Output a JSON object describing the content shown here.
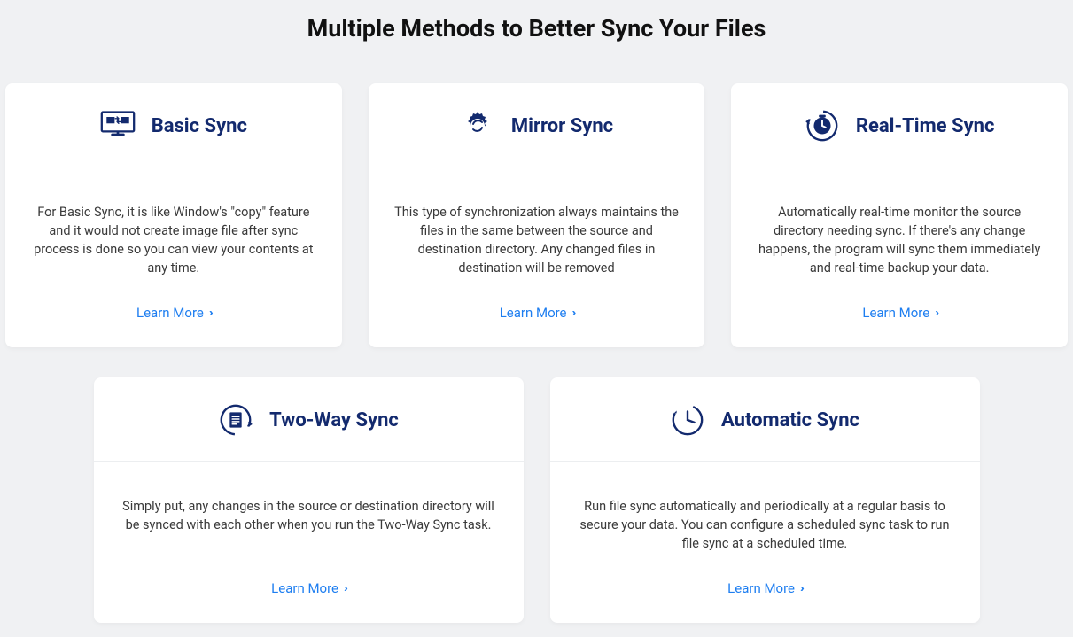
{
  "title": "Multiple Methods to Better Sync Your Files",
  "cards": [
    {
      "heading": "Basic Sync",
      "desc": "For Basic Sync, it is like Window's \"copy\" feature and it would not create image file after sync process is done so you can view your contents at any time.",
      "link": "Learn More"
    },
    {
      "heading": "Mirror Sync",
      "desc": "This type of synchronization always maintains the files in the same between the source and destination directory. Any changed files in destination will be removed",
      "link": "Learn More"
    },
    {
      "heading": "Real-Time Sync",
      "desc": "Automatically real-time monitor the source directory needing sync. If there's any change happens, the program will sync them immediately and real-time backup your data.",
      "link": "Learn More"
    },
    {
      "heading": "Two-Way Sync",
      "desc": "Simply put, any changes in the source or destination directory will be synced with each other when you run the Two-Way Sync task.",
      "link": "Learn More"
    },
    {
      "heading": "Automatic Sync",
      "desc": "Run file sync automatically and periodically at a regular basis to secure your data. You can configure a scheduled sync task to run file sync at a scheduled time.",
      "link": "Learn More"
    }
  ]
}
